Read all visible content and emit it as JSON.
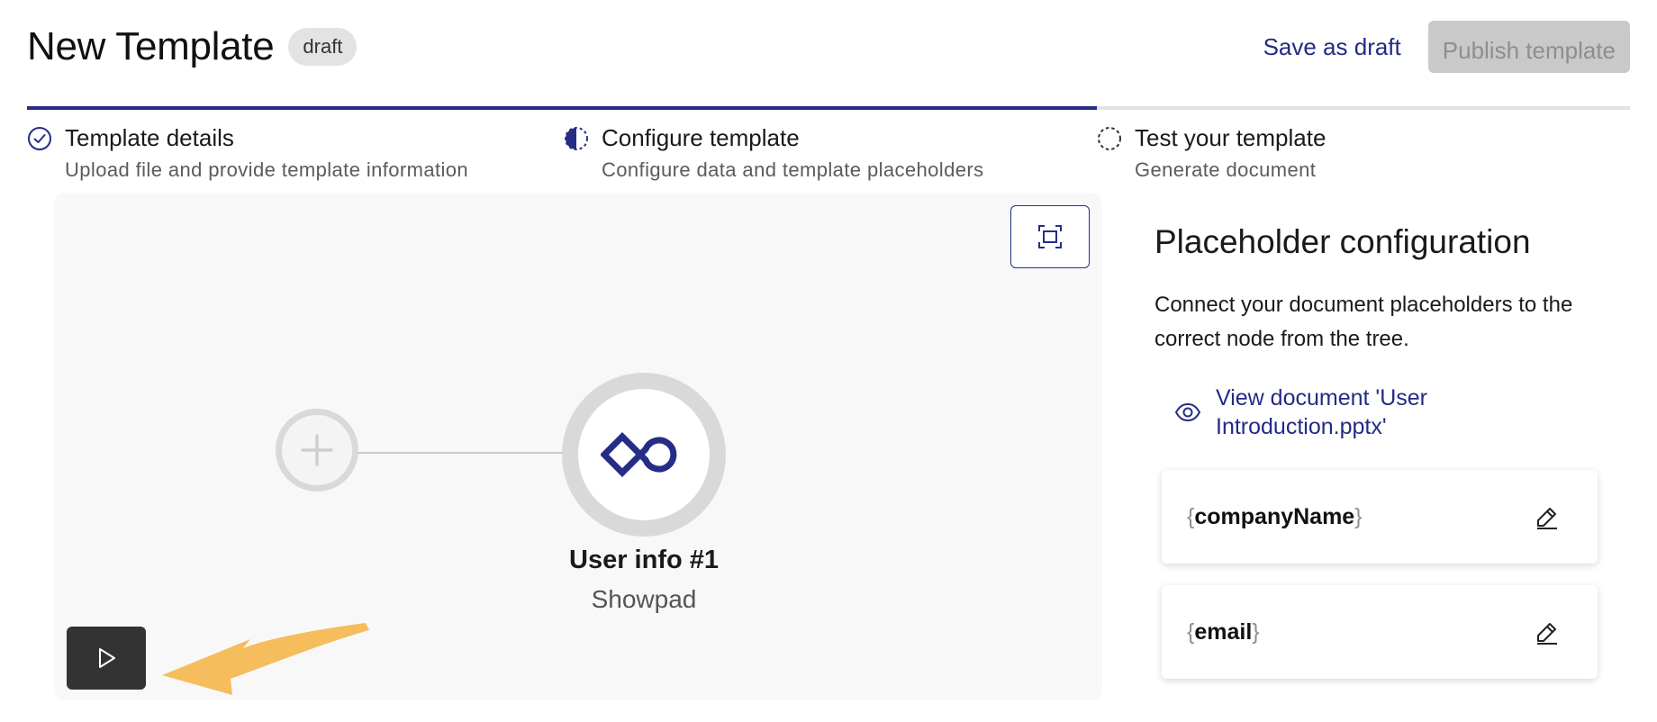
{
  "header": {
    "title": "New Template",
    "badge": "draft",
    "save_draft_label": "Save as draft",
    "publish_label": "Publish template"
  },
  "stepper": {
    "progress_fraction": 0.67,
    "steps": [
      {
        "title": "Template details",
        "subtitle": "Upload file and provide template information",
        "status": "complete",
        "icon": "check-circle-icon"
      },
      {
        "title": "Configure template",
        "subtitle": "Configure data and template placeholders",
        "status": "in-progress",
        "icon": "half-circle-icon"
      },
      {
        "title": "Test your template",
        "subtitle": "Generate document",
        "status": "pending",
        "icon": "dashed-circle-icon"
      }
    ]
  },
  "canvas": {
    "node": {
      "title": "User info #1",
      "subtitle": "Showpad",
      "icon": "showpad-logo-icon"
    },
    "add_icon": "plus-icon",
    "fit_icon": "fit-screen-icon",
    "play_icon": "play-icon"
  },
  "panel": {
    "title": "Placeholder configuration",
    "description": "Connect your document placeholders to the correct node from the tree.",
    "view_document_label": "View document 'User Introduction.pptx'",
    "placeholders": [
      {
        "open": "{",
        "name": "companyName",
        "close": "}"
      },
      {
        "open": "{",
        "name": "email",
        "close": "}"
      }
    ]
  },
  "colors": {
    "accent": "#262d86",
    "link": "#232b85",
    "annotation_arrow": "#f5bd5c",
    "disabled_button": "#c9c9c9"
  }
}
